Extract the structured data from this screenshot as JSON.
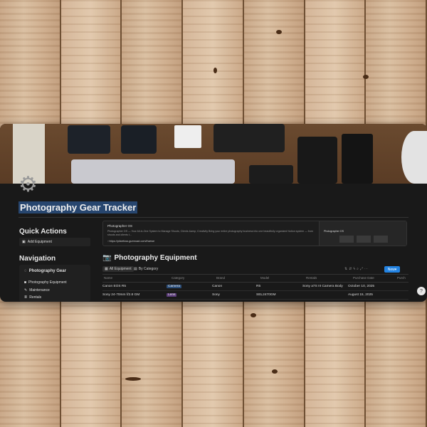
{
  "page": {
    "title": "Photography Gear Tracker"
  },
  "quick_actions": {
    "heading": "Quick Actions",
    "add_button": "Add Equipment"
  },
  "navigation": {
    "heading": "Navigation",
    "section": "Photography Gear",
    "items": [
      {
        "label": "Photography Equipment",
        "icon": "camera-icon"
      },
      {
        "label": "Maintenance",
        "icon": "wrench-icon"
      },
      {
        "label": "Rentals",
        "icon": "list-icon"
      }
    ]
  },
  "bookmark": {
    "title": "Photographer OS",
    "description": "Photographer OS — Your All-in-One System to Manage Shoots, Clients &amp; Creativity Bring your entire photography business into one beautifully organized Notion system — from shoots and clients t...",
    "url": "https://pilarrfuss.gumroad.com/l/wewe",
    "thumb_title": "Photographer OS"
  },
  "database": {
    "title": "Photography Equipment",
    "tabs": [
      {
        "label": "All Equipment",
        "active": true
      },
      {
        "label": "By Category",
        "active": false
      }
    ],
    "new_label": "New",
    "columns": [
      "Name",
      "Category",
      "Brand",
      "Model",
      "Rentals",
      "Purchase Date",
      "Purch"
    ],
    "rows": [
      {
        "name": "Canon EOS R5",
        "category": "Camera",
        "category_color": "#2b4d78",
        "brand": "Canon",
        "model": "R5",
        "rentals": "Sony a7S III Camera Body",
        "purchase_date": "October 10, 2025"
      },
      {
        "name": "Sony 24-70mm f/2.8 GM",
        "category": "Lens",
        "category_color": "#5a3a78",
        "brand": "Sony",
        "model": "SEL2470GM",
        "rentals": "",
        "purchase_date": "August 15, 2025"
      }
    ]
  },
  "colors": {
    "window_bg": "#191919",
    "title_highlight": "#27466f",
    "accent": "#2383e2"
  }
}
